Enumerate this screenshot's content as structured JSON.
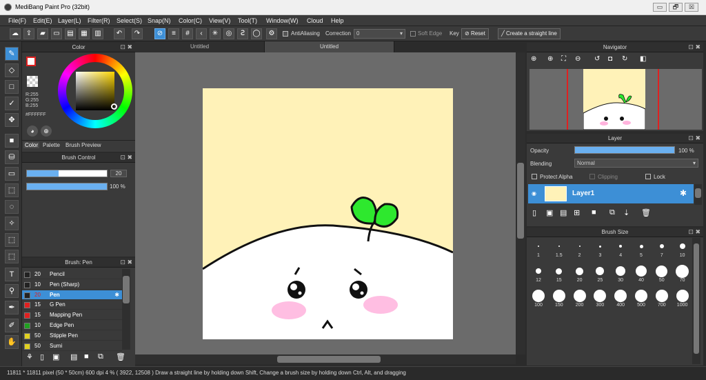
{
  "window": {
    "title": "MediBang Paint Pro (32bit)",
    "buttons": [
      "▭",
      "🗗",
      "☒"
    ]
  },
  "menu": [
    "File(F)",
    "Edit(E)",
    "Layer(L)",
    "Filter(R)",
    "Select(S)",
    "Snap(N)",
    "Color(C)",
    "View(V)",
    "Tool(T)",
    "Window(W)",
    "Cloud",
    "Help"
  ],
  "toolbar": {
    "antialiasing": "AntiAliasing",
    "correction_label": "Correction",
    "correction_value": "0",
    "soft_edge": "Soft Edge",
    "key": "Key",
    "reset": "Reset",
    "straight_line": "Create a straight line"
  },
  "tabs": [
    "Untitled",
    "Untitled"
  ],
  "color_panel": {
    "title": "Color",
    "r": "R:255",
    "g": "G:255",
    "b": "B:255",
    "hex": "#FFFFFF",
    "tabs": [
      "Color",
      "Palette",
      "Brush Preview"
    ]
  },
  "brush_control": {
    "title": "Brush Control",
    "size": "20",
    "opacity": "100 %"
  },
  "brush_panel": {
    "title": "Brush: Pen",
    "items": [
      {
        "size": "20",
        "name": "Pencil",
        "color": "#222222"
      },
      {
        "size": "10",
        "name": "Pen (Sharp)",
        "color": "#222222"
      },
      {
        "size": "20",
        "name": "Pen",
        "color": "#222222",
        "selected": true
      },
      {
        "size": "15",
        "name": "G Pen",
        "color": "#e02020"
      },
      {
        "size": "15",
        "name": "Mapping Pen",
        "color": "#e02020"
      },
      {
        "size": "10",
        "name": "Edge Pen",
        "color": "#20a020"
      },
      {
        "size": "50",
        "name": "Stipple Pen",
        "color": "#e0d020"
      },
      {
        "size": "50",
        "name": "Sumi",
        "color": "#e0d020"
      }
    ]
  },
  "navigator": {
    "title": "Navigator"
  },
  "layer_panel": {
    "title": "Layer",
    "opacity_label": "Opacity",
    "opacity_value": "100 %",
    "blending_label": "Blending",
    "blending_value": "Normal",
    "protect_alpha": "Protect Alpha",
    "clipping": "Clipping",
    "lock": "Lock",
    "layer_name": "Layer1"
  },
  "brush_size": {
    "title": "Brush Size",
    "sizes": [
      "1",
      "1.5",
      "2",
      "3",
      "4",
      "5",
      "7",
      "10",
      "12",
      "15",
      "20",
      "25",
      "30",
      "40",
      "50",
      "70",
      "100",
      "150",
      "200",
      "300",
      "400",
      "500",
      "700",
      "1000"
    ]
  },
  "status": {
    "text": "11811 * 11811 pixel  (50 * 50cm)  600 dpi  4 %  ( 3922, 12508 )  Draw a straight line by holding down Shift, Change a brush size by holding down Ctrl, Alt, and dragging"
  },
  "colors": {
    "accent": "#3d8fd6",
    "canvas": "#fff2b8",
    "sprout": "#2ee82e"
  }
}
